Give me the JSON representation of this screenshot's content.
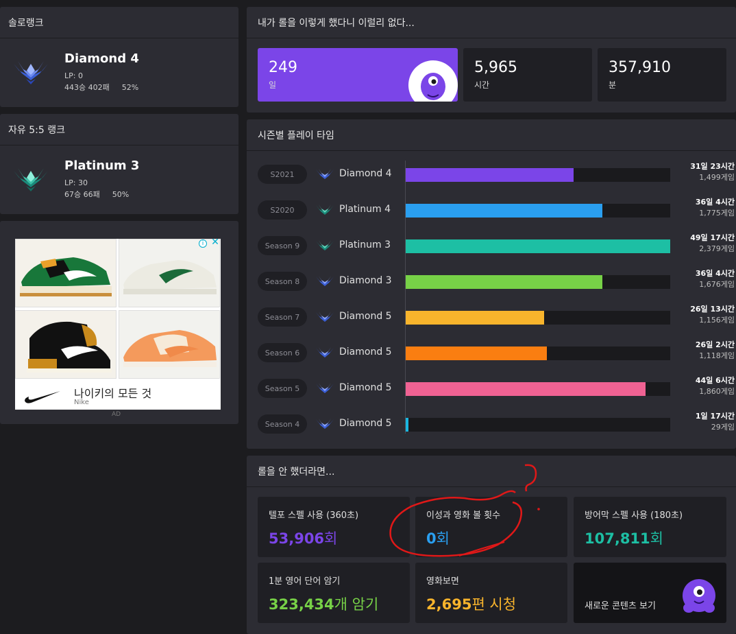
{
  "solo": {
    "title": "솔로랭크",
    "tier": "Diamond 4",
    "lp": "LP: 0",
    "record": "443승 402패",
    "winrate": "52%"
  },
  "flex": {
    "title": "자유 5:5 랭크",
    "tier": "Platinum 3",
    "lp": "LP: 30",
    "record": "67승 66패",
    "winrate": "50%"
  },
  "ad": {
    "text": "나이키의 모든 것",
    "brand": "Nike",
    "label": "AD",
    "info_icon": "info-icon",
    "close_icon": "close-icon"
  },
  "headline": {
    "title": "내가 롤을 이렇게 했다니 이럴리 없다...",
    "stats": [
      {
        "value": "249",
        "unit": "일",
        "color": "#7b45e8"
      },
      {
        "value": "5,965",
        "unit": "시간"
      },
      {
        "value": "357,910",
        "unit": "분"
      }
    ]
  },
  "seasons": {
    "title": "시즌별 플레이 타임",
    "rows": [
      {
        "season": "S2021",
        "tier": "Diamond 4",
        "time": "31일 23시간",
        "games": "1,499게임",
        "fill": 0.635,
        "color": "#7b45e8",
        "emblem": "diamond"
      },
      {
        "season": "S2020",
        "tier": "Platinum 4",
        "time": "36일 4시간",
        "games": "1,775게임",
        "fill": 0.743,
        "color": "#2a9ff0",
        "emblem": "platinum"
      },
      {
        "season": "Season 9",
        "tier": "Platinum 3",
        "time": "49일 17시간",
        "games": "2,379게임",
        "fill": 1.0,
        "color": "#1dbfa4",
        "emblem": "platinum"
      },
      {
        "season": "Season 8",
        "tier": "Diamond 3",
        "time": "36일 4시간",
        "games": "1,676게임",
        "fill": 0.743,
        "color": "#77d147",
        "emblem": "diamond"
      },
      {
        "season": "Season 7",
        "tier": "Diamond 5",
        "time": "26일 13시간",
        "games": "1,156게임",
        "fill": 0.523,
        "color": "#f8b42c",
        "emblem": "diamond"
      },
      {
        "season": "Season 6",
        "tier": "Diamond 5",
        "time": "26일 2시간",
        "games": "1,118게임",
        "fill": 0.534,
        "color": "#fa7e11",
        "emblem": "diamond"
      },
      {
        "season": "Season 5",
        "tier": "Diamond 5",
        "time": "44일 6시간",
        "games": "1,860게임",
        "fill": 0.907,
        "color": "#f06293",
        "emblem": "diamond"
      },
      {
        "season": "Season 4",
        "tier": "Diamond 5",
        "time": "1일 17시간",
        "games": "29게임",
        "fill": 0.01,
        "color": "#1ab6e0",
        "emblem": "diamond"
      }
    ]
  },
  "ifnot": {
    "title": "롤을 안 했더라면...",
    "facts": [
      {
        "label": "텔포 스펠 사용 (360초)",
        "number": "53,906",
        "unit": "회",
        "color": "#7b45e8"
      },
      {
        "label": "이성과 영화 볼 횟수",
        "number": "0",
        "unit": "회",
        "color": "#2a9ff0"
      },
      {
        "label": "방어막 스펠 사용 (180초)",
        "number": "107,811",
        "unit": "회",
        "color": "#1dbfa4"
      },
      {
        "label": "1분 영어 단어 암기",
        "number": "323,434",
        "unit": "개 암기",
        "color": "#77d147"
      },
      {
        "label": "영화보면",
        "number": "2,695",
        "unit": "편 시청",
        "color": "#f8b42c"
      }
    ],
    "new_content": "새로운 콘텐츠 보기"
  },
  "annotation": {
    "mark": "?",
    "color": "#e01818"
  }
}
